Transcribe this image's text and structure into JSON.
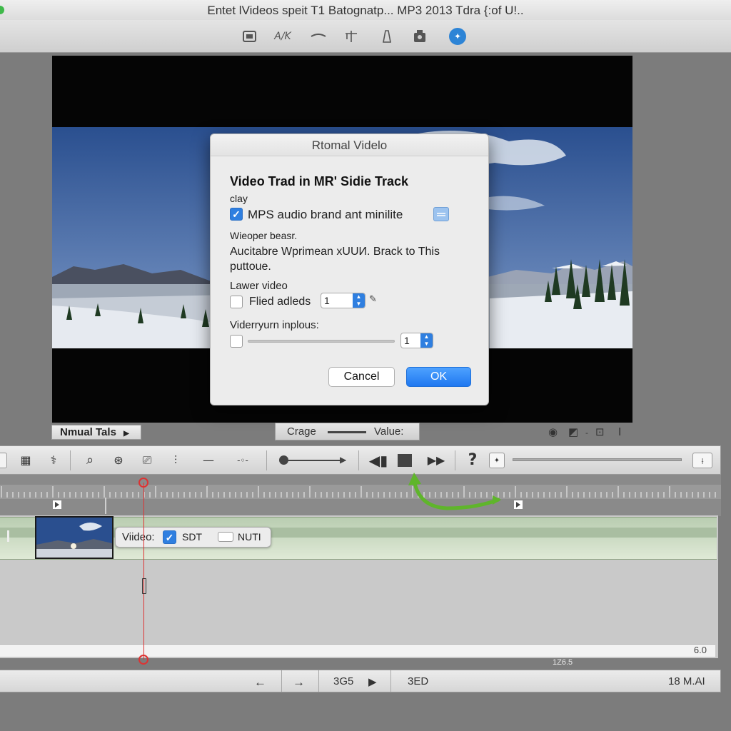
{
  "window": {
    "title": "Entet lVideos speit T1 Batognatp... MP3 2013 Tdra {:of U!.."
  },
  "toolbar": {
    "icons": [
      "import-icon",
      "text-icon",
      "transition-icon",
      "crop-icon",
      "export-icon",
      "camera-icon",
      "share-icon"
    ],
    "text_icon_label": "A/K"
  },
  "dialog": {
    "title": "Rtomal Videlo",
    "heading": "Video Trad in MR' Sidie Track",
    "sub_label": "clay",
    "checkbox1_label": "MPS audio brand ant minilite",
    "checkbox1_checked": true,
    "section_label": "Wieoper beasr.",
    "description": "Aucitabre Wprimean хUUИ. Brack to This puttoue.",
    "lower_heading": "Lawer video",
    "filed_label": "Flied adleds",
    "filed_value": "1",
    "range_heading": "Viderryurn inplous:",
    "range_value": "1",
    "cancel_label": "Cancel",
    "ok_label": "OK"
  },
  "viewer_bar": {
    "left_button": "Nmual Tals",
    "crage_label": "Crage",
    "value_label": "Value:"
  },
  "track_popover": {
    "video_label": "Viideo:",
    "sdt_label": "SDT",
    "sdt_checked": true,
    "nuti_label": "NUTI"
  },
  "timeline": {
    "scroll_label": "6.0",
    "timecode_small": "1Z6.5"
  },
  "status_bar": {
    "value_a": "3G5",
    "value_b": "3ED",
    "size": "18 M.AI"
  }
}
